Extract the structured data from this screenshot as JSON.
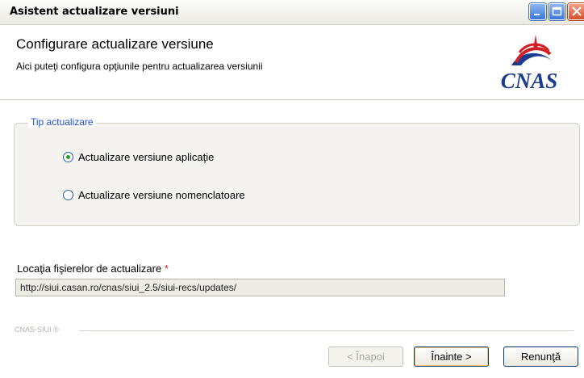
{
  "window": {
    "title": "Asistent actualizare versiuni"
  },
  "header": {
    "title": "Configurare actualizare versiune",
    "subtitle": "Aici puteţi configura opţiunile pentru actualizarea versiunii",
    "logo_text": "CNAS"
  },
  "update_type": {
    "legend": "Tip actualizare",
    "options": [
      {
        "label": "Actualizare versiune aplicaţie",
        "selected": true
      },
      {
        "label": "Actualizare versiune nomenclatoare",
        "selected": false
      }
    ]
  },
  "location": {
    "label": "Locaţia fişierelor de actualizare",
    "required_mark": "*",
    "value": "http://siui.casan.ro/cnas/siui_2.5/siui-recs/updates/"
  },
  "footer": {
    "brand": "CNAS-SIUI ®",
    "back_label": "< Înapoi",
    "next_label": "Înainte >",
    "cancel_label": "Renunţă"
  },
  "colors": {
    "accent_blue": "#1f4fd1",
    "required_red": "#dd2222",
    "logo_red": "#d41f26",
    "logo_blue": "#1d3b8f"
  }
}
